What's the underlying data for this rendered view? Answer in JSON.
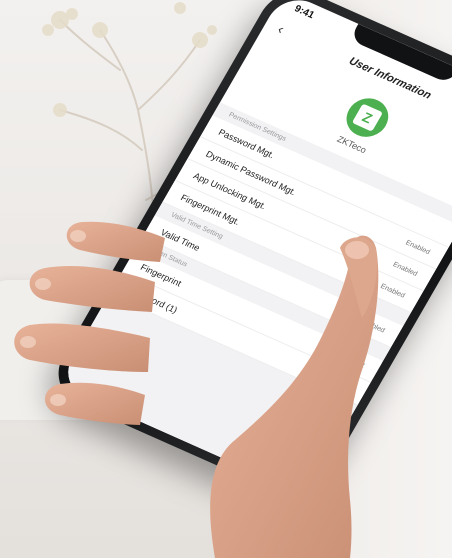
{
  "status_time": "9:41",
  "nav": {
    "back_icon": "chevron-left",
    "title": "User Information"
  },
  "profile": {
    "logo_letter": "Z",
    "brand_name": "ZKTeco"
  },
  "sections": [
    {
      "header": "Permission Settings",
      "rows": [
        {
          "label": "Password Mgt.",
          "value": ""
        },
        {
          "label": "Dynamic Password Mgt.",
          "value": "Enabled"
        },
        {
          "label": "App Unlocking Mgt.",
          "value": "Enabled"
        },
        {
          "label": "Fingerprint Mgt.",
          "value": "Enabled"
        }
      ]
    },
    {
      "header": "Valid Time Setting",
      "rows": [
        {
          "label": "Valid Time",
          "value": "Enabled"
        }
      ]
    },
    {
      "header": "Open Status",
      "rows": [
        {
          "label": "Fingerprint",
          "value": "Permanent"
        },
        {
          "label": "Password (1)",
          "value": "›"
        }
      ]
    }
  ],
  "colors": {
    "brand_green": "#4caf50",
    "phone_frame": "#111214",
    "background": "#eeeceb"
  }
}
